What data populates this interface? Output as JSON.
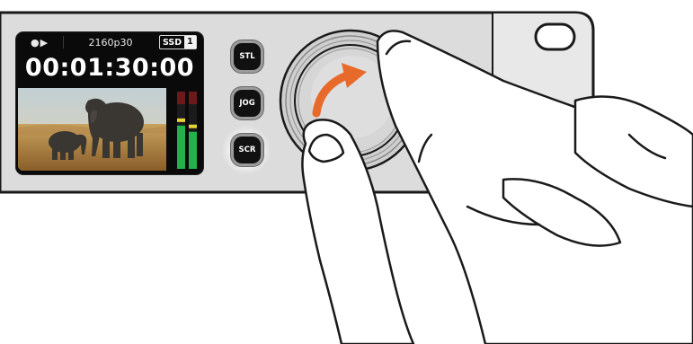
{
  "display": {
    "transport_icon": "play-icon",
    "transport_glyph": "●▶",
    "format": "2160p30",
    "media_label": "SSD",
    "media_slot": "1",
    "timecode": "00:01:30:00",
    "preview_content": "elephants-on-savanna-image"
  },
  "buttons": {
    "stl": "STL",
    "jog": "JOG",
    "scr": "SCR",
    "active": "SCR"
  },
  "audio_meters": {
    "channels": [
      {
        "level": 0.56
      },
      {
        "level": 0.48
      }
    ],
    "colors": {
      "green": "#22b14c",
      "yellow": "#e7d23a",
      "red": "#8b1a1a"
    }
  },
  "jog_wheel": {
    "rotation_arrow_icon": "clockwise-arrow-icon",
    "arrow_color": "#e86a2a"
  },
  "colors": {
    "panel": "#d9d9d9",
    "panel_edge": "#1a1a1a",
    "right_panel": "#e6e6e6"
  }
}
